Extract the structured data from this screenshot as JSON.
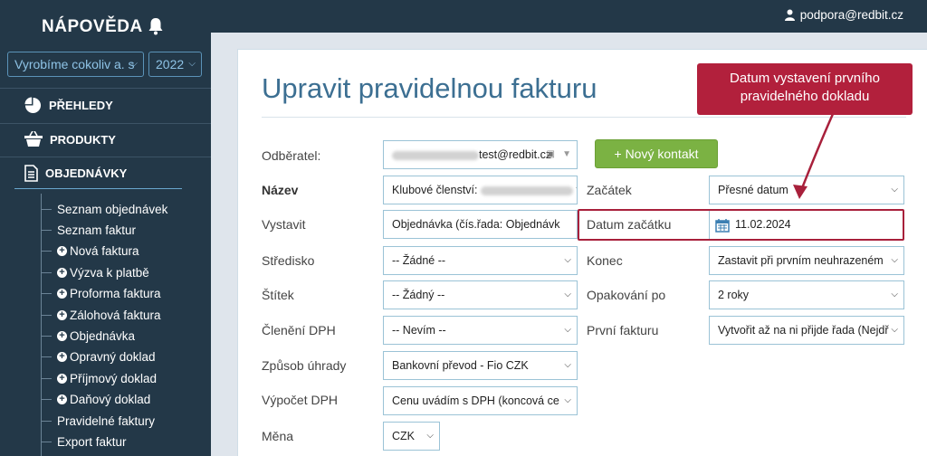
{
  "sidebar": {
    "brand": "NÁPOVĚDA",
    "company_select": "Vyrobíme cokoliv a. s",
    "year_select": "2022",
    "menu": [
      {
        "label": "PŘEHLEDY",
        "icon": "pie-chart-icon"
      },
      {
        "label": "PRODUKTY",
        "icon": "basket-icon"
      },
      {
        "label": "OBJEDNÁVKY",
        "icon": "document-icon"
      }
    ],
    "submenu": [
      {
        "label": "Seznam objednávek",
        "plus": false
      },
      {
        "label": "Seznam faktur",
        "plus": false
      },
      {
        "label": "Nová faktura",
        "plus": true
      },
      {
        "label": "Výzva k platbě",
        "plus": true
      },
      {
        "label": "Proforma faktura",
        "plus": true
      },
      {
        "label": "Zálohová faktura",
        "plus": true
      },
      {
        "label": "Objednávka",
        "plus": true
      },
      {
        "label": "Opravný doklad",
        "plus": true
      },
      {
        "label": "Příjmový doklad",
        "plus": true
      },
      {
        "label": "Daňový doklad",
        "plus": true
      },
      {
        "label": "Pravidelné faktury",
        "plus": false
      },
      {
        "label": "Export faktur",
        "plus": false
      }
    ]
  },
  "header": {
    "user_email": "podpora@redbit.cz"
  },
  "main": {
    "title": "Upravit pravidelnou fakturu",
    "new_contact_button": "+ Nový kontakt",
    "left_fields": {
      "odberatel": {
        "label": "Odběratel:",
        "value": "test@redbit.cz"
      },
      "nazev": {
        "label": "Název",
        "value_prefix": "Klubové členství:",
        "value_suffix": "tes"
      },
      "vystavit": {
        "label": "Vystavit",
        "value": "Objednávka (čís.řada: Objednávk"
      },
      "stredisko": {
        "label": "Středisko",
        "value": "-- Žádné --"
      },
      "stitek": {
        "label": "Štítek",
        "value": "-- Žádný --"
      },
      "cleneni_dph": {
        "label": "Členění DPH",
        "value": "-- Nevím --"
      },
      "zpusob_uhrady": {
        "label": "Způsob úhrady",
        "value": "Bankovní převod - Fio CZK"
      },
      "vypocet_dph": {
        "label": "Výpočet DPH",
        "value": "Cenu uvádím s DPH (koncová ce"
      },
      "mena": {
        "label": "Měna",
        "value": "CZK"
      }
    },
    "right_fields": {
      "zacatek": {
        "label": "Začátek",
        "value": "Přesné datum"
      },
      "datum_zacatku": {
        "label": "Datum začátku",
        "value": "11.02.2024"
      },
      "konec": {
        "label": "Konec",
        "value": "Zastavit při prvním neuhrazeném"
      },
      "opakovani": {
        "label": "Opakování po",
        "value": "2 roky"
      },
      "prvni_fakturu": {
        "label": "První fakturu",
        "value": "Vytvořit až na ni přijde řada (Nejdř"
      }
    },
    "callout_line1": "Datum vystavení prvního",
    "callout_line2": "pravidelného dokladu"
  },
  "colors": {
    "sidebar": "#233848",
    "accent_title": "#3c6f92",
    "green_button": "#7bb243",
    "callout": "#b2203c"
  }
}
